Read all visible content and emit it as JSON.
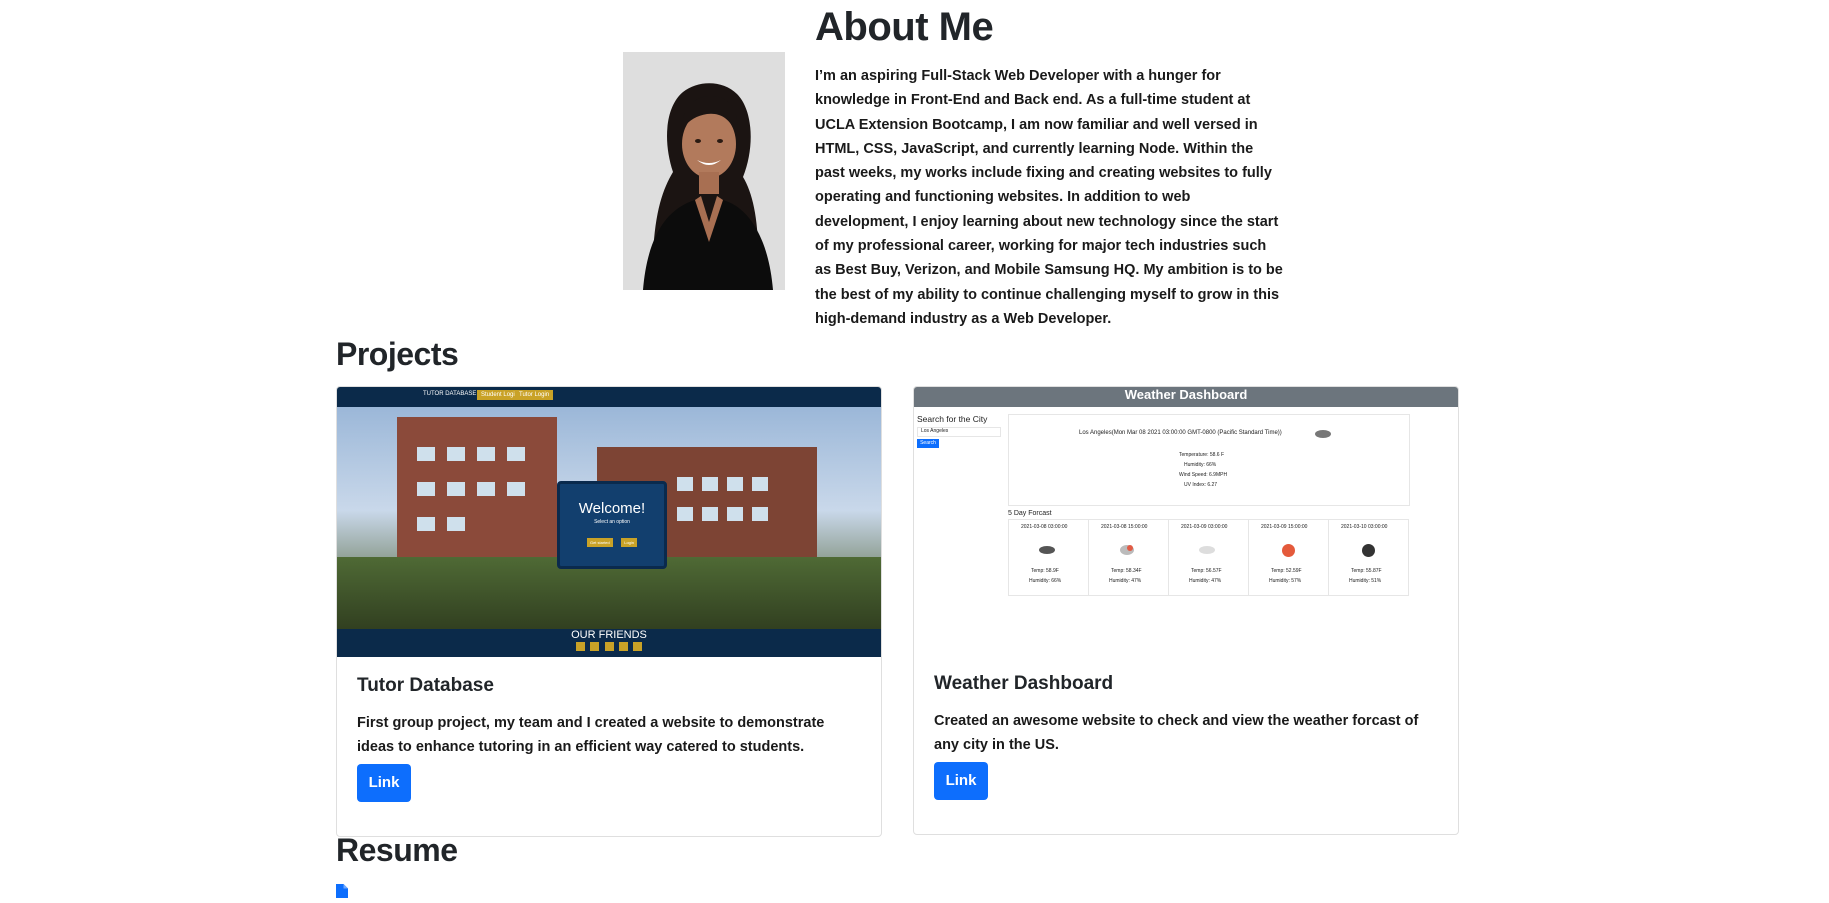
{
  "about": {
    "title": "About Me",
    "bio": "I’m an aspiring Full-Stack Web Developer with a hunger for knowledge in Front-End and Back end. As a full-time student at UCLA Extension Bootcamp, I am now familiar and well versed in HTML, CSS, JavaScript, and currently learning Node. Within the past weeks, my works include fixing and creating websites to fully operating and functioning websites. In addition to web development, I enjoy learning about new technology since the start of my professional career, working for major tech industries such as Best Buy, Verizon, and Mobile Samsung HQ. My ambition is to be the best of my ability to continue challenging myself to grow in this high-demand industry as a Web Developer."
  },
  "projects": {
    "title": "Projects",
    "items": [
      {
        "title": "Tutor Database",
        "description": "First group project, my team and I created a website to demonstrate ideas to enhance tutoring in an efficient way catered to students.",
        "link_label": "Link",
        "screenshot": {
          "nav_brand": "TUTOR DATABASE",
          "nav_btn1": "Student Login",
          "nav_btn2": "Tutor Login",
          "welcome": "Welcome!",
          "welcome_sub": "Select an option",
          "welcome_btn1": "Get started",
          "welcome_btn2": "Login",
          "footer": "OUR FRIENDS"
        }
      },
      {
        "title": "Weather Dashboard",
        "description": "Created an awesome website to check and view the weather forcast of any city in the US.",
        "link_label": "Link",
        "screenshot": {
          "header": "Weather Dashboard",
          "search_label": "Search for the City",
          "search_value": "Los Angeles",
          "search_btn": "Search",
          "current_city": "Los Angeles(Mon Mar 08 2021 03:00:00 GMT-0800 (Pacific Standard Time))",
          "temperature": "Temperature: 58.6 F",
          "humidity": "Humidity: 66%",
          "wind": "Wind Speed: 6.9MPH",
          "uv": "UV Index: 6.27",
          "forecast_label": "5 Day Forcast",
          "forecast": [
            {
              "date": "2021-03-08 03:00:00",
              "temp": "Temp: 58.9F",
              "humidity": "Humidity: 66%"
            },
            {
              "date": "2021-03-08 15:00:00",
              "temp": "Temp: 58.34F",
              "humidity": "Humidity: 47%"
            },
            {
              "date": "2021-03-09 03:00:00",
              "temp": "Temp: 56.57F",
              "humidity": "Humidity: 47%"
            },
            {
              "date": "2021-03-09 15:00:00",
              "temp": "Temp: 52.59F",
              "humidity": "Humidity: 57%"
            },
            {
              "date": "2021-03-10 03:00:00",
              "temp": "Temp: 55.87F",
              "humidity": "Humidity: 51%"
            }
          ]
        }
      }
    ]
  },
  "resume": {
    "title": "Resume",
    "icon": "file-icon"
  },
  "colors": {
    "primary": "#0d6efd",
    "weather_header": "#6c757d",
    "tutor_nav": "#0b2a4a"
  }
}
